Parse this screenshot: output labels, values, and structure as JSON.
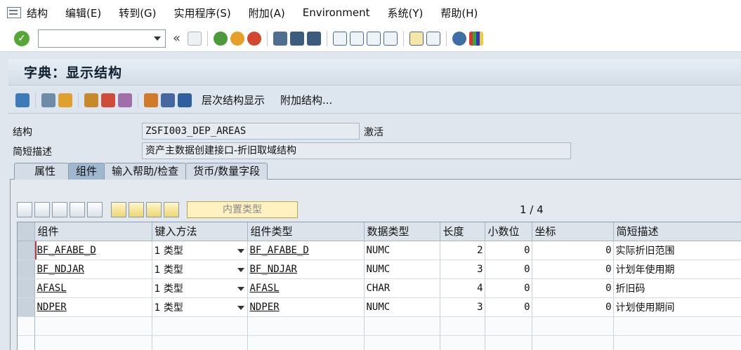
{
  "menu": {
    "items": [
      "结构",
      "编辑(E)",
      "转到(G)",
      "实用程序(S)",
      "附加(A)",
      "Environment",
      "系统(Y)",
      "帮助(H)"
    ]
  },
  "toolbar": {
    "command_value": "",
    "nav_text": "«"
  },
  "title": "字典：显示结构",
  "app_toolbar": {
    "hierarchy_label": "层次结构显示",
    "append_label": "附加结构..."
  },
  "fields": {
    "structure_label": "结构",
    "structure_value": "ZSFI003_DEP_AREAS",
    "status_value": "激活",
    "desc_label": "简短描述",
    "desc_value": "资产主数据创建接口-折旧取域结构"
  },
  "tabs": [
    "属性",
    "组件",
    "输入帮助/检查",
    "货币/数量字段"
  ],
  "active_tab": "组件",
  "table_toolbar": {
    "builtin_type_label": "内置类型",
    "pager": "1 / 4"
  },
  "table": {
    "columns": [
      "组件",
      "键入方法",
      "组件类型",
      "数据类型",
      "长度",
      "小数位",
      "坐标",
      "简短描述"
    ],
    "rows": [
      {
        "component": "BF_AFABE_D",
        "method": "1 类型",
        "ctype": "BF_AFABE_D",
        "dtype": "NUMC",
        "length": "2",
        "decimals": "0",
        "coord": "0",
        "desc": "实际折旧范围"
      },
      {
        "component": "BF_NDJAR",
        "method": "1 类型",
        "ctype": "BF_NDJAR",
        "dtype": "NUMC",
        "length": "3",
        "decimals": "0",
        "coord": "0",
        "desc": "计划年使用期"
      },
      {
        "component": "AFASL",
        "method": "1 类型",
        "ctype": "AFASL",
        "dtype": "CHAR",
        "length": "4",
        "decimals": "0",
        "coord": "0",
        "desc": "折旧码"
      },
      {
        "component": "NDPER",
        "method": "1 类型",
        "ctype": "NDPER",
        "dtype": "NUMC",
        "length": "3",
        "decimals": "0",
        "coord": "0",
        "desc": "计划使用期间"
      }
    ]
  },
  "colors": {
    "ok_green": "#56a836",
    "builtin_btn_bg": "#fff1c0",
    "active_tab": "#9fb7cf"
  }
}
